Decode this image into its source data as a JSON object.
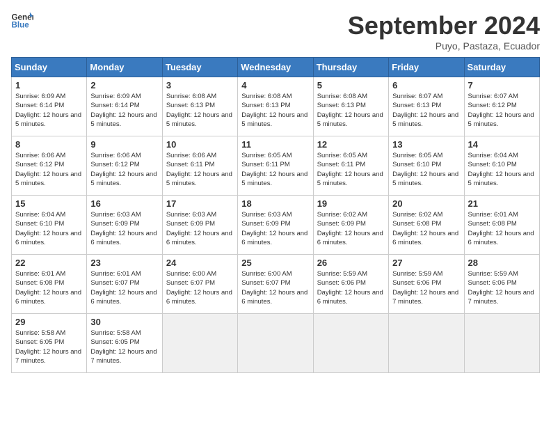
{
  "header": {
    "logo_line1": "General",
    "logo_line2": "Blue",
    "month_title": "September 2024",
    "subtitle": "Puyo, Pastaza, Ecuador"
  },
  "weekdays": [
    "Sunday",
    "Monday",
    "Tuesday",
    "Wednesday",
    "Thursday",
    "Friday",
    "Saturday"
  ],
  "weeks": [
    [
      {
        "day": "1",
        "detail": "Sunrise: 6:09 AM\nSunset: 6:14 PM\nDaylight: 12 hours\nand 5 minutes."
      },
      {
        "day": "2",
        "detail": "Sunrise: 6:09 AM\nSunset: 6:14 PM\nDaylight: 12 hours\nand 5 minutes."
      },
      {
        "day": "3",
        "detail": "Sunrise: 6:08 AM\nSunset: 6:13 PM\nDaylight: 12 hours\nand 5 minutes."
      },
      {
        "day": "4",
        "detail": "Sunrise: 6:08 AM\nSunset: 6:13 PM\nDaylight: 12 hours\nand 5 minutes."
      },
      {
        "day": "5",
        "detail": "Sunrise: 6:08 AM\nSunset: 6:13 PM\nDaylight: 12 hours\nand 5 minutes."
      },
      {
        "day": "6",
        "detail": "Sunrise: 6:07 AM\nSunset: 6:13 PM\nDaylight: 12 hours\nand 5 minutes."
      },
      {
        "day": "7",
        "detail": "Sunrise: 6:07 AM\nSunset: 6:12 PM\nDaylight: 12 hours\nand 5 minutes."
      }
    ],
    [
      {
        "day": "8",
        "detail": "Sunrise: 6:06 AM\nSunset: 6:12 PM\nDaylight: 12 hours\nand 5 minutes."
      },
      {
        "day": "9",
        "detail": "Sunrise: 6:06 AM\nSunset: 6:12 PM\nDaylight: 12 hours\nand 5 minutes."
      },
      {
        "day": "10",
        "detail": "Sunrise: 6:06 AM\nSunset: 6:11 PM\nDaylight: 12 hours\nand 5 minutes."
      },
      {
        "day": "11",
        "detail": "Sunrise: 6:05 AM\nSunset: 6:11 PM\nDaylight: 12 hours\nand 5 minutes."
      },
      {
        "day": "12",
        "detail": "Sunrise: 6:05 AM\nSunset: 6:11 PM\nDaylight: 12 hours\nand 5 minutes."
      },
      {
        "day": "13",
        "detail": "Sunrise: 6:05 AM\nSunset: 6:10 PM\nDaylight: 12 hours\nand 5 minutes."
      },
      {
        "day": "14",
        "detail": "Sunrise: 6:04 AM\nSunset: 6:10 PM\nDaylight: 12 hours\nand 5 minutes."
      }
    ],
    [
      {
        "day": "15",
        "detail": "Sunrise: 6:04 AM\nSunset: 6:10 PM\nDaylight: 12 hours\nand 6 minutes."
      },
      {
        "day": "16",
        "detail": "Sunrise: 6:03 AM\nSunset: 6:09 PM\nDaylight: 12 hours\nand 6 minutes."
      },
      {
        "day": "17",
        "detail": "Sunrise: 6:03 AM\nSunset: 6:09 PM\nDaylight: 12 hours\nand 6 minutes."
      },
      {
        "day": "18",
        "detail": "Sunrise: 6:03 AM\nSunset: 6:09 PM\nDaylight: 12 hours\nand 6 minutes."
      },
      {
        "day": "19",
        "detail": "Sunrise: 6:02 AM\nSunset: 6:09 PM\nDaylight: 12 hours\nand 6 minutes."
      },
      {
        "day": "20",
        "detail": "Sunrise: 6:02 AM\nSunset: 6:08 PM\nDaylight: 12 hours\nand 6 minutes."
      },
      {
        "day": "21",
        "detail": "Sunrise: 6:01 AM\nSunset: 6:08 PM\nDaylight: 12 hours\nand 6 minutes."
      }
    ],
    [
      {
        "day": "22",
        "detail": "Sunrise: 6:01 AM\nSunset: 6:08 PM\nDaylight: 12 hours\nand 6 minutes."
      },
      {
        "day": "23",
        "detail": "Sunrise: 6:01 AM\nSunset: 6:07 PM\nDaylight: 12 hours\nand 6 minutes."
      },
      {
        "day": "24",
        "detail": "Sunrise: 6:00 AM\nSunset: 6:07 PM\nDaylight: 12 hours\nand 6 minutes."
      },
      {
        "day": "25",
        "detail": "Sunrise: 6:00 AM\nSunset: 6:07 PM\nDaylight: 12 hours\nand 6 minutes."
      },
      {
        "day": "26",
        "detail": "Sunrise: 5:59 AM\nSunset: 6:06 PM\nDaylight: 12 hours\nand 6 minutes."
      },
      {
        "day": "27",
        "detail": "Sunrise: 5:59 AM\nSunset: 6:06 PM\nDaylight: 12 hours\nand 7 minutes."
      },
      {
        "day": "28",
        "detail": "Sunrise: 5:59 AM\nSunset: 6:06 PM\nDaylight: 12 hours\nand 7 minutes."
      }
    ],
    [
      {
        "day": "29",
        "detail": "Sunrise: 5:58 AM\nSunset: 6:05 PM\nDaylight: 12 hours\nand 7 minutes."
      },
      {
        "day": "30",
        "detail": "Sunrise: 5:58 AM\nSunset: 6:05 PM\nDaylight: 12 hours\nand 7 minutes."
      },
      {
        "day": "",
        "detail": ""
      },
      {
        "day": "",
        "detail": ""
      },
      {
        "day": "",
        "detail": ""
      },
      {
        "day": "",
        "detail": ""
      },
      {
        "day": "",
        "detail": ""
      }
    ]
  ]
}
